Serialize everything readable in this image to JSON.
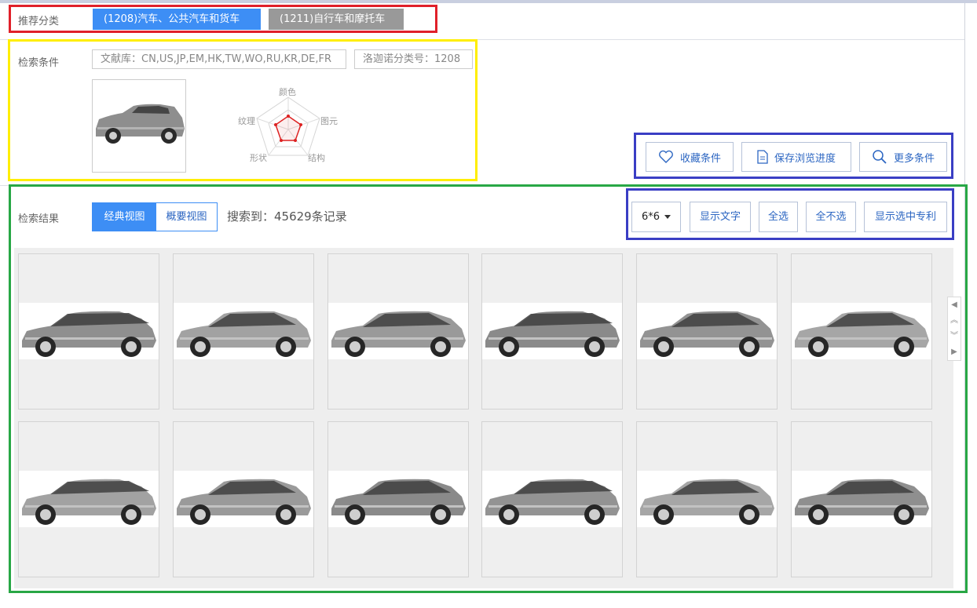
{
  "recommend": {
    "label": "推荐分类",
    "categories": [
      {
        "label": "(1208)汽车、公共汽车和货车",
        "active": true
      },
      {
        "label": "(1211)自行车和摩托车",
        "active": false
      }
    ]
  },
  "conditions": {
    "label": "检索条件",
    "database": "文献库：CN,US,JP,EM,HK,TW,WO,RU,KR,DE,FR",
    "locarno": "洛迦诺分类号：1208",
    "radar": {
      "top": "颜色",
      "right": "图元",
      "bottom_right": "结构",
      "bottom_left": "形状",
      "left": "纹理"
    }
  },
  "actions": {
    "favorite": "收藏条件",
    "save_progress": "保存浏览进度",
    "more": "更多条件"
  },
  "results": {
    "label": "检索结果",
    "views": {
      "classic": "经典视图",
      "summary": "概要视图"
    },
    "count": "搜索到：45629条记录",
    "grid_select": "6*6",
    "show_text": "显示文字",
    "select_all": "全选",
    "select_none": "全不选",
    "show_selected": "显示选中专利"
  },
  "colors": {
    "accent": "#3d8ef5",
    "link": "#2c66c2",
    "gray_btn": "#999999"
  },
  "icons": {
    "favorite": "heart-icon",
    "save": "document-icon",
    "more": "search-icon",
    "pager_prev": "triangle-left-icon",
    "pager_up": "double-chevron-up-icon",
    "pager_down": "double-chevron-down-icon",
    "pager_next": "triangle-right-icon"
  }
}
